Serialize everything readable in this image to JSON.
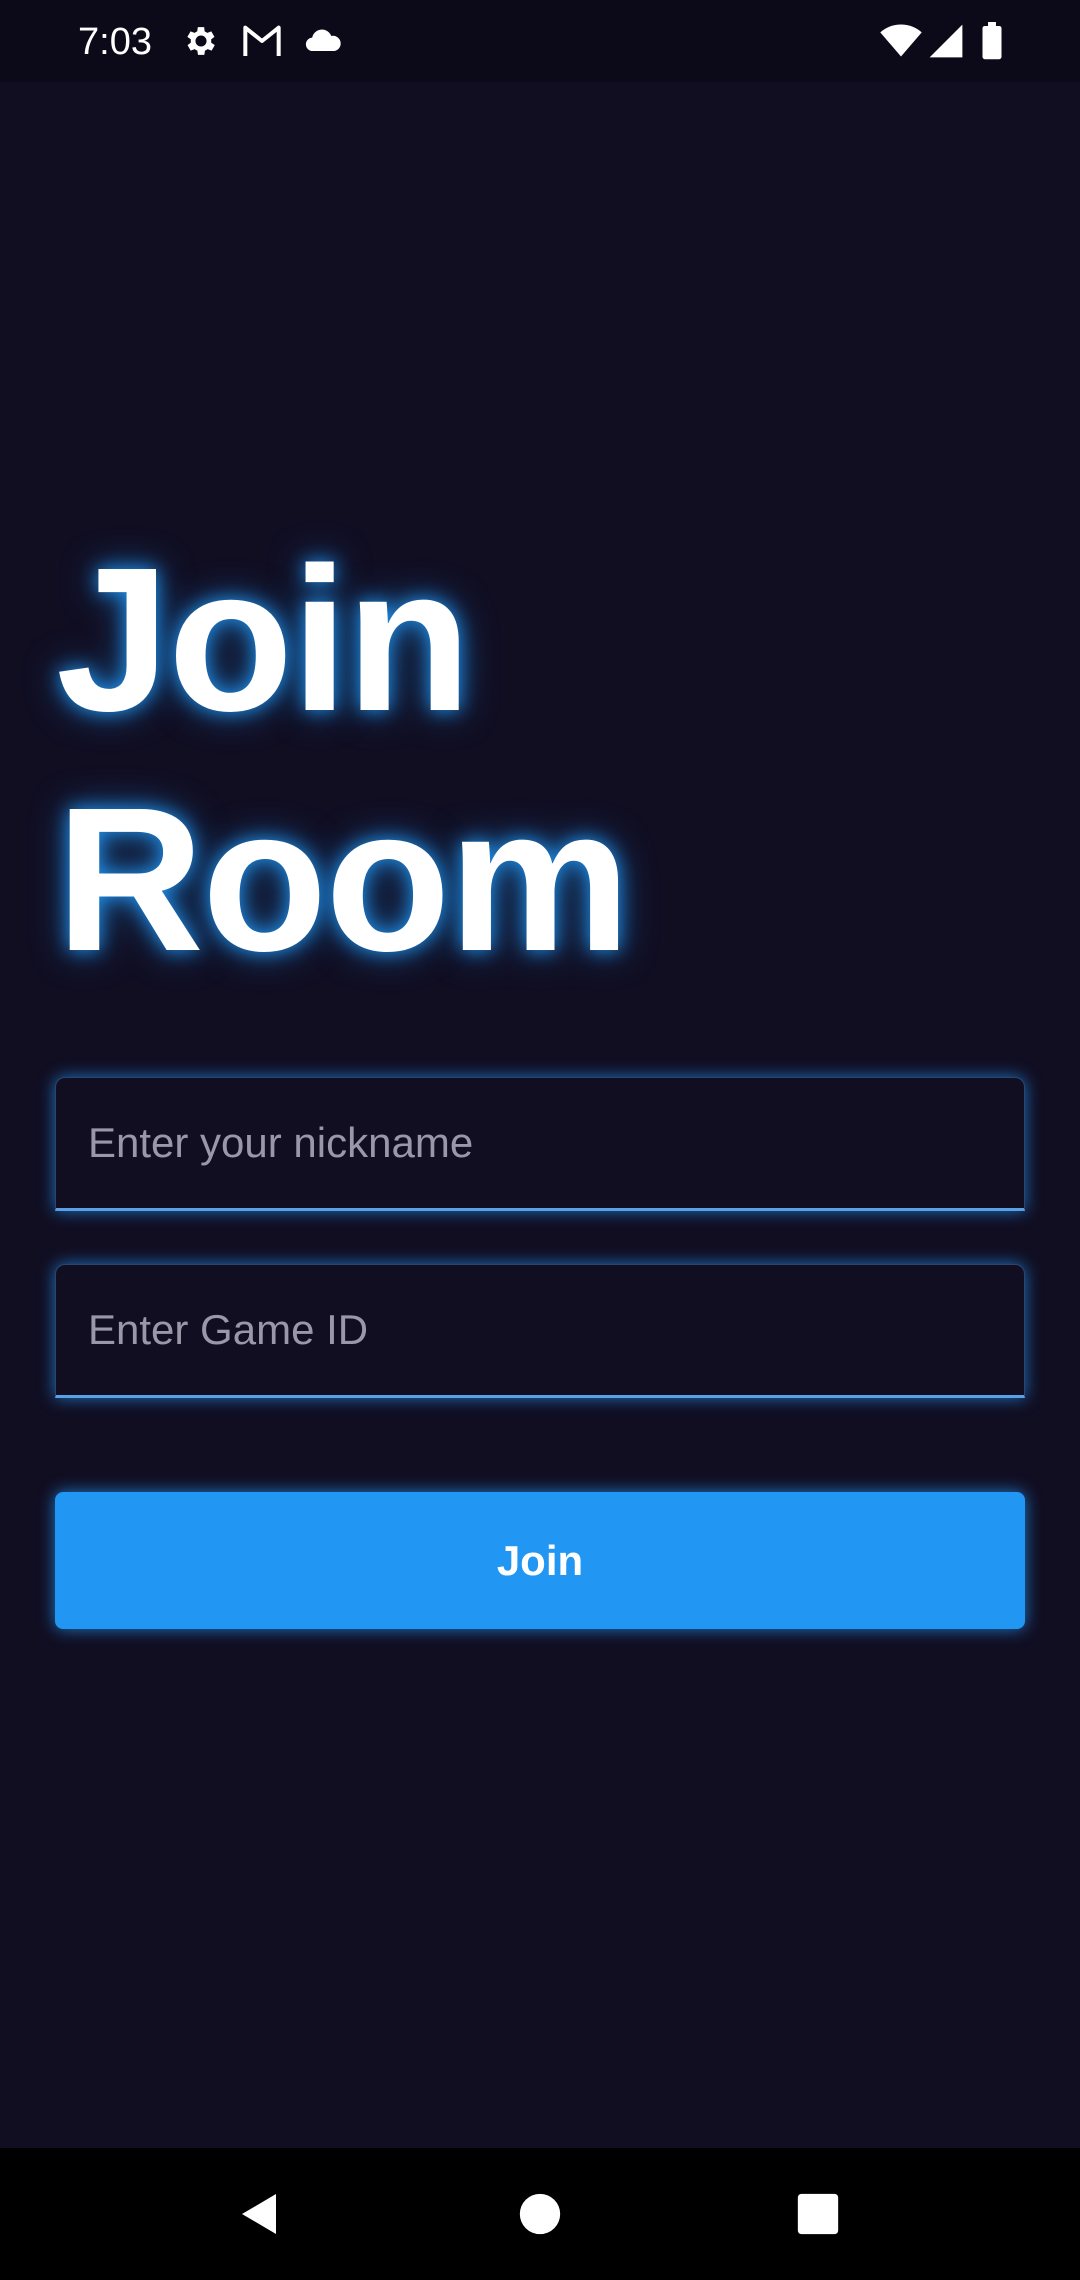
{
  "status_bar": {
    "time": "7:03",
    "icons": [
      "settings-icon",
      "gmail-icon",
      "cloud-icon",
      "wifi-icon",
      "cell-signal-icon",
      "battery-icon"
    ]
  },
  "title": {
    "line1": "Join",
    "line2": "Room"
  },
  "form": {
    "nickname_placeholder": "Enter your nickname",
    "nickname_value": "",
    "game_id_placeholder": "Enter Game ID",
    "game_id_value": "",
    "join_label": "Join"
  },
  "nav_bar": {
    "icons": [
      "back-icon",
      "home-icon",
      "recents-icon"
    ]
  },
  "colors": {
    "background": "#110e22",
    "accent": "#2196f3",
    "text": "#ffffff",
    "placeholder": "#9a98a8"
  }
}
